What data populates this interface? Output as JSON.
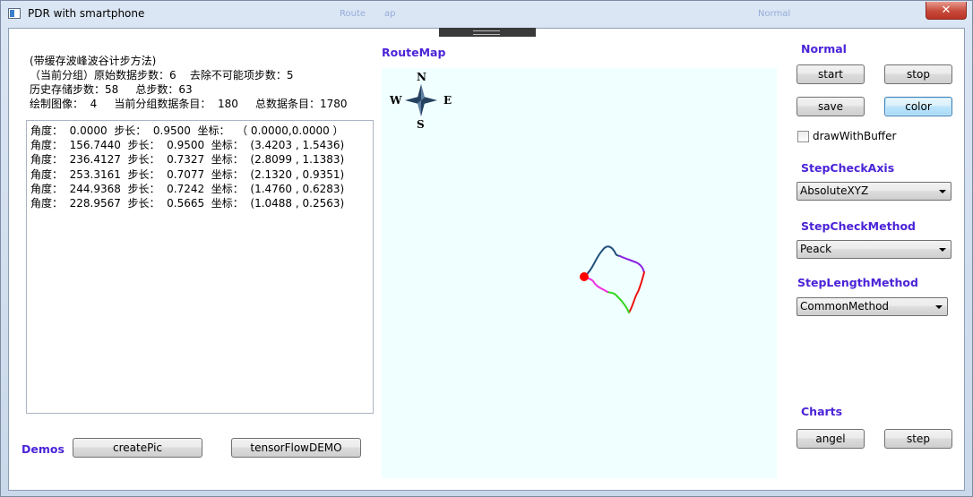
{
  "window": {
    "title": "PDR  with smartphone",
    "ghost_left": "Route",
    "ghost_mid": "ap",
    "ghost_right": "Normal",
    "close_glyph": "✕"
  },
  "info": {
    "line1": "(带缓存波峰波谷计步方法)",
    "line2": "（当前分组）原始数据步数：6    去除不可能项步数：5",
    "line3": "历史存储步数：58     总步数：63",
    "line4": "绘制图像：  4     当前分组数据条目：  180     总数据条目：1780"
  },
  "log": [
    "角度：  0.0000  步长：  0.9500  坐标：  （ 0.0000,0.0000 ）",
    "角度：  156.7440  步长：  0.9500  坐标：  (3.4203 , 1.5436)",
    "角度：  236.4127  步长：  0.7327  坐标：  (2.8099 , 1.1383)",
    "角度：  253.3161  步长：  0.7077  坐标：  (2.1320 , 0.9351)",
    "角度：  244.9368  步长：  0.7242  坐标：  (1.4760 , 0.6283)",
    "角度：  228.9567  步长：  0.5665  坐标：  (1.0488 , 0.2563)"
  ],
  "demos": {
    "label": "Demos",
    "create_pic": "createPic",
    "tensorflow": "tensorFlowDEMO"
  },
  "routemap": {
    "label": "RouteMap",
    "compass": {
      "n": "N",
      "s": "S",
      "e": "E",
      "w": "W"
    },
    "colors": {
      "background": "#f0ffff",
      "start_dot": "#ff0000"
    }
  },
  "controls": {
    "normal_label": "Normal",
    "start": "start",
    "stop": "stop",
    "save": "save",
    "color": "color",
    "draw_with_buffer": "drawWithBuffer",
    "step_check_axis_label": "StepCheckAxis",
    "step_check_axis_value": "AbsoluteXYZ",
    "step_check_method_label": "StepCheckMethod",
    "step_check_method_value": "Peack",
    "step_length_method_label": "StepLengthMethod",
    "step_length_method_value": "CommonMethod",
    "charts_label": "Charts",
    "angel": "angel",
    "step": "step"
  },
  "theme": {
    "accent_label": "#4b23d8"
  }
}
